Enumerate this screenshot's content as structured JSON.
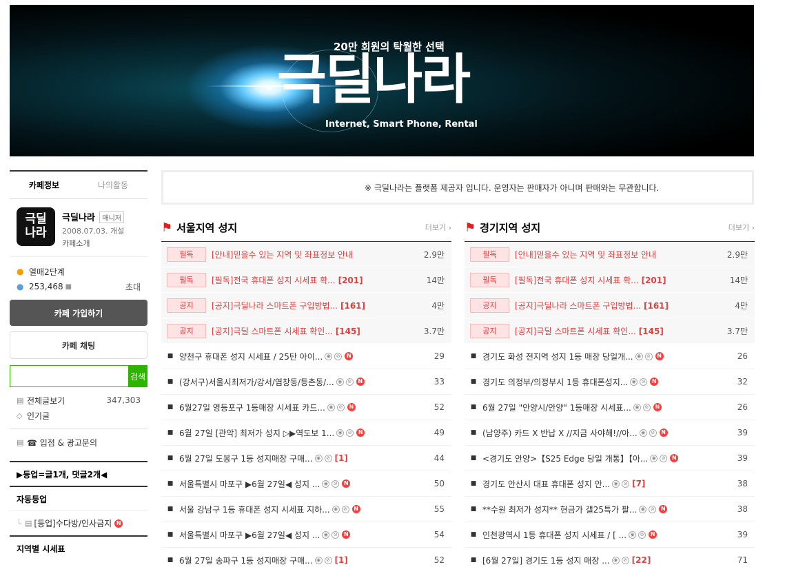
{
  "banner": {
    "top": "20만 회원의 탁월한 선택",
    "main": "극딜나라",
    "sub": "Internet, Smart Phone, Rental"
  },
  "sidebar": {
    "tabs": [
      "카페정보",
      "나의활동"
    ],
    "logo_text": "극딜\n나라",
    "cafe_name": "극딜나라",
    "badge": "매니저",
    "date": "2008.07.03. 개설",
    "intro": "카페소개",
    "level": "열매2단계",
    "members": "253,468",
    "invite": "초대",
    "join": "카페 가입하기",
    "chat": "카페 채팅",
    "search_btn": "검색",
    "all_posts": "전체글보기",
    "all_posts_count": "347,303",
    "popular": "인기글",
    "ad": "☎ 입점 & 광고문의",
    "promo": "▶등업=글1개, 댓글2개◀",
    "auto": "자동등업",
    "auto_item": "[등업]수다방/인사금지",
    "region": "지역별 시세표"
  },
  "notice": "※ 극딜나라는 플랫폼 제공자 입니다. 운영자는 판매자가 아니며 판매와는 무관합니다.",
  "boards": {
    "seoul": {
      "title": "서울지역 성지",
      "more": "더보기",
      "notices": [
        {
          "tag": "필독",
          "title": "[안내]믿을수 있는 지역 및 좌표정보 안내",
          "cnt": "",
          "count": "2.9만"
        },
        {
          "tag": "필독",
          "title": "[필독]전국 휴대폰 성지 시세표 확...",
          "cnt": "[201]",
          "count": "14만"
        },
        {
          "tag": "공지",
          "title": "[공지]극딜나라 스마트폰 구입방법...",
          "cnt": "[161]",
          "count": "4만"
        },
        {
          "tag": "공지",
          "title": "[공지]극딜 스마트폰 시세표 확인...",
          "cnt": "[145]",
          "count": "3.7만"
        }
      ],
      "posts": [
        {
          "title": "양천구 휴대폰 성지 시세표 / 25탄 아이...",
          "cnt": "",
          "count": "29"
        },
        {
          "title": "(강서구)서울시최저가/강서/염창동/등촌동/...",
          "cnt": "",
          "count": "33"
        },
        {
          "title": "6월27일 영등포구 1등매장 시세표 카드...",
          "cnt": "",
          "count": "52"
        },
        {
          "title": "6월 27일 [관악] 최저가 성지 ▷▶역도보 1...",
          "cnt": "",
          "count": "49"
        },
        {
          "title": "6월 27일 도봉구 1등 성지매장 구매...",
          "cnt": "[1]",
          "count": "44"
        },
        {
          "title": "서울특별시 마포구 ▶6월 27일◀ 성지 ...",
          "cnt": "",
          "count": "50"
        },
        {
          "title": "서울 강남구 1등 휴대폰 성지 시세표 지하...",
          "cnt": "",
          "count": "55"
        },
        {
          "title": "서울특별시 마포구 ▶6월 27일◀ 성지 ...",
          "cnt": "",
          "count": "54"
        },
        {
          "title": "6월 27일 송파구 1등 성지매장 구매...",
          "cnt": "[1]",
          "count": "52"
        }
      ]
    },
    "gyeonggi": {
      "title": "경기지역 성지",
      "more": "더보기",
      "notices": [
        {
          "tag": "필독",
          "title": "[안내]믿을수 있는 지역 및 좌표정보 안내",
          "cnt": "",
          "count": "2.9만"
        },
        {
          "tag": "필독",
          "title": "[필독]전국 휴대폰 성지 시세표 확...",
          "cnt": "[201]",
          "count": "14만"
        },
        {
          "tag": "공지",
          "title": "[공지]극딜나라 스마트폰 구입방법...",
          "cnt": "[161]",
          "count": "4만"
        },
        {
          "tag": "공지",
          "title": "[공지]극딜 스마트폰 시세표 확인...",
          "cnt": "[145]",
          "count": "3.7만"
        }
      ],
      "posts": [
        {
          "title": "경기도 화성 전지역 성지 1등 매장 당일개...",
          "cnt": "",
          "count": "26"
        },
        {
          "title": "경기도 의정부/의정부시 1등 휴대폰성지...",
          "cnt": "",
          "count": "32"
        },
        {
          "title": "6월 27일 \"안양시/안양\" 1등매장 시세표...",
          "cnt": "",
          "count": "26"
        },
        {
          "title": "(남양주) 카드 X 반납 X //지금 사야해!//아...",
          "cnt": "",
          "count": "39"
        },
        {
          "title": "<경기도 안양>【S25 Edge 당일 개통】【아...",
          "cnt": "",
          "count": "39"
        },
        {
          "title": "경기도 안산시 대표 휴대폰 성지 안...",
          "cnt": "[7]",
          "count": "38"
        },
        {
          "title": "**수원 최저가 성지** 현금가 갤25특가 팔...",
          "cnt": "",
          "count": "38"
        },
        {
          "title": "인천광역시 1등 휴대폰 성지 시세표 / [ ...",
          "cnt": "",
          "count": "39"
        },
        {
          "title": "[6월 27일] 경기도 1등 성지 매장 ...",
          "cnt": "[22]",
          "count": "71"
        }
      ]
    }
  }
}
